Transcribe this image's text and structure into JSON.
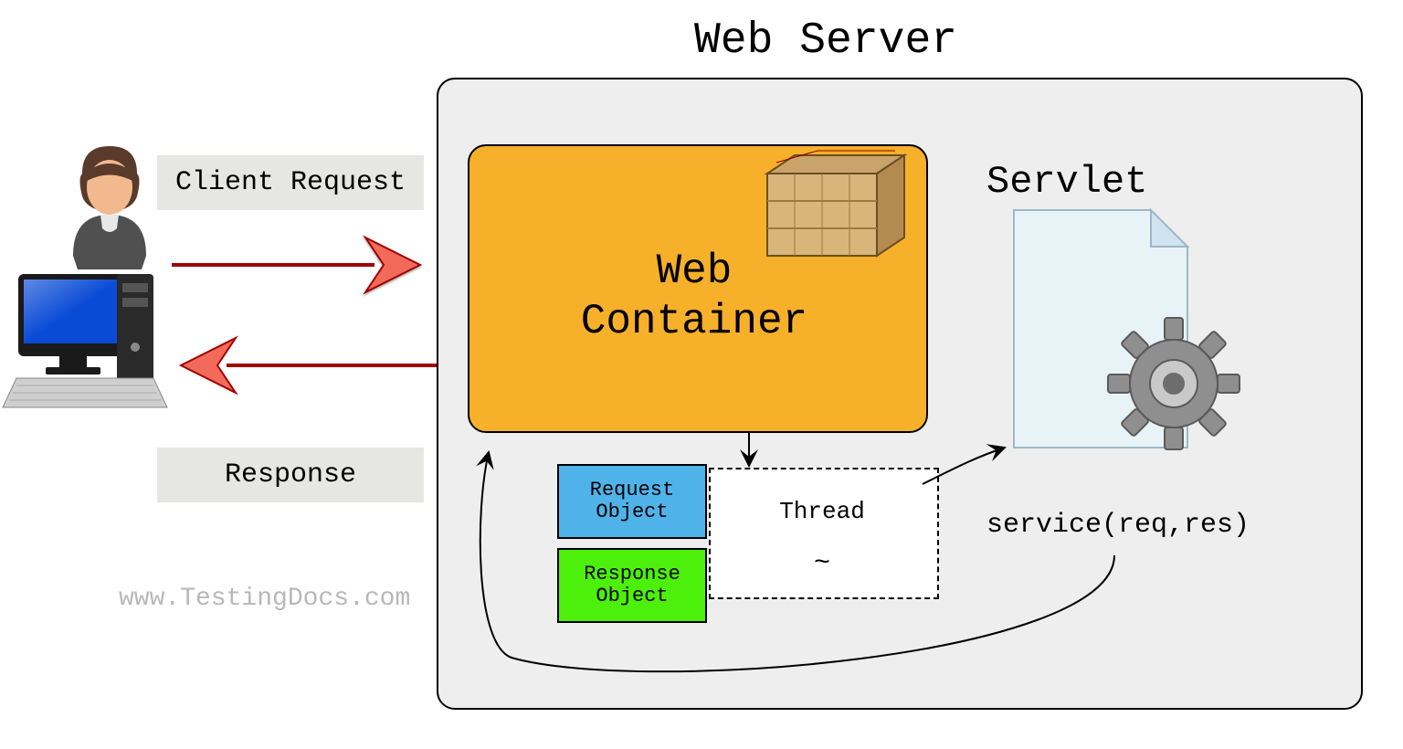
{
  "title": "Web Server",
  "client_request": "Client Request",
  "response": "Response",
  "web_container": "Web\nContainer",
  "request_object": "Request\nObject",
  "response_object": "Response\nObject",
  "thread": "Thread",
  "tilde": "~",
  "servlet": "Servlet",
  "service_call": "service(req,res)",
  "watermark": "www.TestingDocs.com",
  "chart_data": {
    "type": "flow-diagram",
    "nodes": [
      {
        "id": "client",
        "label": "Client (user + computer)",
        "kind": "actor"
      },
      {
        "id": "web_server",
        "label": "Web Server",
        "kind": "container"
      },
      {
        "id": "web_container",
        "label": "Web Container",
        "kind": "component",
        "parent": "web_server"
      },
      {
        "id": "thread",
        "label": "Thread",
        "kind": "process",
        "parent": "web_server"
      },
      {
        "id": "request_object",
        "label": "Request Object",
        "kind": "object",
        "parent": "web_server"
      },
      {
        "id": "response_object",
        "label": "Response Object",
        "kind": "object",
        "parent": "web_server"
      },
      {
        "id": "servlet",
        "label": "Servlet",
        "kind": "component",
        "parent": "web_server"
      }
    ],
    "edges": [
      {
        "from": "client",
        "to": "web_server",
        "label": "Client Request"
      },
      {
        "from": "web_server",
        "to": "client",
        "label": "Response"
      },
      {
        "from": "web_container",
        "to": "thread",
        "label": ""
      },
      {
        "from": "thread",
        "to": "servlet",
        "label": "service(req,res)"
      },
      {
        "from": "servlet",
        "to": "web_container",
        "label": "",
        "note": "return"
      }
    ]
  }
}
